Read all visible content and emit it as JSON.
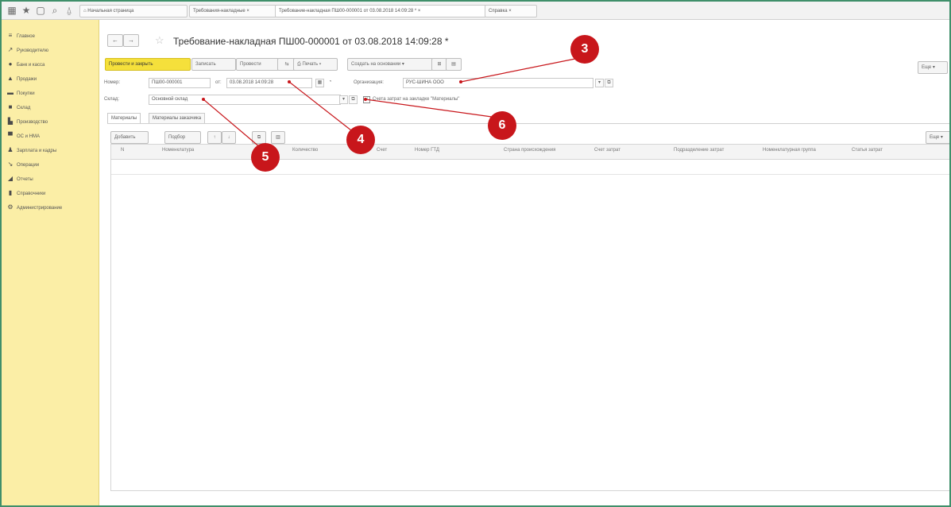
{
  "topbar": {
    "icons": [
      "grid-icon",
      "star-icon",
      "history-icon",
      "search-icon",
      "bell-icon"
    ],
    "tabs": [
      {
        "label": "Начальная страница",
        "active": false
      },
      {
        "label": "Требования-накладные ×",
        "active": false
      },
      {
        "label": "Требование-накладная ПШ00-000001 от 03.08.2018 14:09:28 * ×",
        "active": true
      },
      {
        "label": "Справка ×",
        "active": false
      }
    ]
  },
  "sidebar": {
    "items": [
      {
        "icon": "menu-icon",
        "label": "Главное"
      },
      {
        "icon": "chart-icon",
        "label": "Руководителю"
      },
      {
        "icon": "bank-icon",
        "label": "Банк и касса"
      },
      {
        "icon": "sales-icon",
        "label": "Продажи"
      },
      {
        "icon": "cart-icon",
        "label": "Покупки"
      },
      {
        "icon": "warehouse-icon",
        "label": "Склад"
      },
      {
        "icon": "production-icon",
        "label": "Производство"
      },
      {
        "icon": "assets-icon",
        "label": "ОС и НМА"
      },
      {
        "icon": "person-icon",
        "label": "Зарплата и кадры"
      },
      {
        "icon": "operations-icon",
        "label": "Операции"
      },
      {
        "icon": "reports-icon",
        "label": "Отчеты"
      },
      {
        "icon": "book-icon",
        "label": "Справочники"
      },
      {
        "icon": "gear-icon",
        "label": "Администрирование"
      }
    ]
  },
  "document": {
    "back_label": "←",
    "forward_label": "→",
    "title": "Требование-накладная ПШ00-000001 от 03.08.2018 14:09:28 *"
  },
  "toolbar": {
    "post_close": "Провести и закрыть",
    "save": "Записать",
    "post": "Провести",
    "print": "Печать",
    "create_based": "Создать на основании",
    "more": "Еще"
  },
  "form": {
    "number_label": "Номер:",
    "number_value": "ПШ00-000001",
    "date_label": "от:",
    "date_value": "03.08.2018 14:09:28",
    "org_label": "Организация:",
    "org_value": "РУС-ШИНА ООО",
    "warehouse_label": "Склад:",
    "warehouse_value": "Основной склад",
    "checkbox_label": "Счета затрат на закладке \"Материалы\"",
    "checkbox_checked": true
  },
  "subtabs": [
    "Материалы",
    "Материалы заказчика"
  ],
  "table_toolbar": {
    "add": "Добавить",
    "select": "Подбор",
    "more": "Еще"
  },
  "table": {
    "columns": [
      "N",
      "Номенклатура",
      "Количество",
      "Счет",
      "Номер ГТД",
      "Страна происхождения",
      "Счет затрат",
      "Подразделение затрат",
      "Номенклатурная группа",
      "Статья затрат"
    ]
  },
  "markers": [
    "3",
    "4",
    "5",
    "6"
  ],
  "colors": {
    "sidebar_bg": "#fbeea6",
    "primary_button": "#f5e03b",
    "marker": "#c8161b",
    "frame_border": "#3f8f6a"
  }
}
